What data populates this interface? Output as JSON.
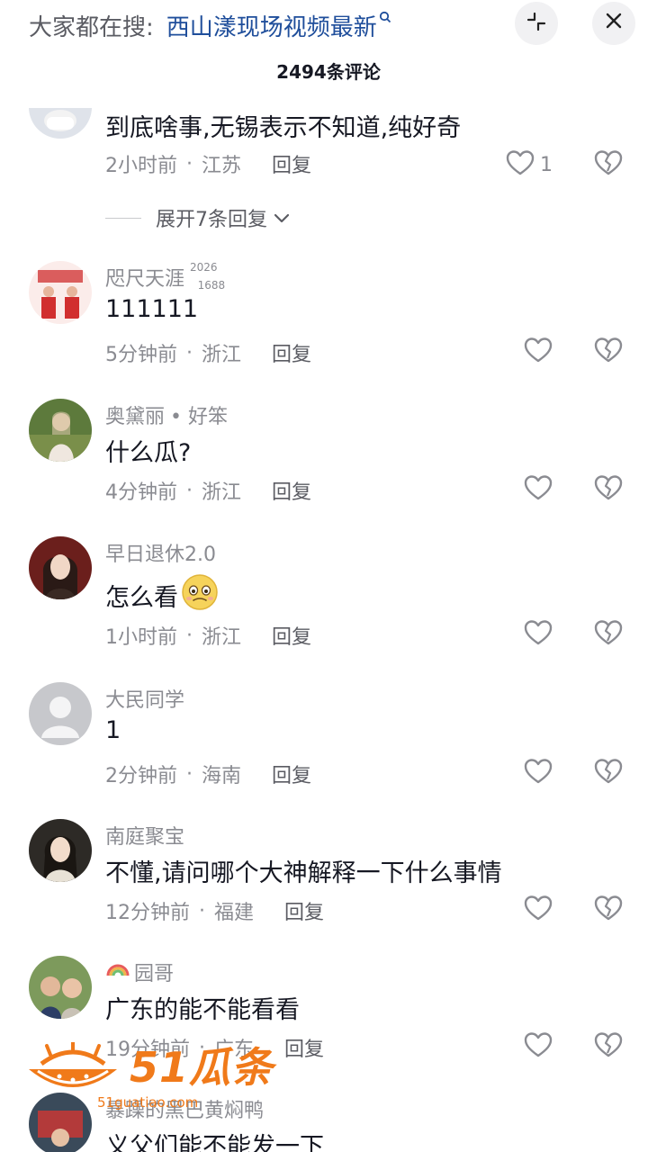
{
  "header": {
    "search_prefix": "大家都在搜:",
    "search_keyword": "西山漾现场视频最新",
    "comment_count": "2494条评论"
  },
  "comments": [
    {
      "text": "到底啥事,无锡表示不知道,纯好奇",
      "time": "2小时前",
      "location": "江苏",
      "reply": "回复",
      "likes": "1",
      "expand": "展开7条回复"
    },
    {
      "username": "咫尺天涯",
      "badge_top": "2026",
      "badge_bottom": "1688",
      "text": "111111",
      "time": "5分钟前",
      "location": "浙江",
      "reply": "回复"
    },
    {
      "username": "奥黛丽",
      "tag": "• 好笨",
      "text": "什么瓜?",
      "time": "4分钟前",
      "location": "浙江",
      "reply": "回复"
    },
    {
      "username": "早日退休2.0",
      "text": "怎么看",
      "time": "1小时前",
      "location": "浙江",
      "reply": "回复"
    },
    {
      "username": "大民同学",
      "text": "1",
      "time": "2分钟前",
      "location": "海南",
      "reply": "回复"
    },
    {
      "username": "南庭聚宝",
      "text": "不懂,请问哪个大神解释一下什么事情",
      "time": "12分钟前",
      "location": "福建",
      "reply": "回复"
    },
    {
      "username": "园哥",
      "text": "广东的能不能看看",
      "time": "19分钟前",
      "location": "广东",
      "reply": "回复"
    },
    {
      "username": "暴躁的黑巴黄焖鸭",
      "text": "义父们能不能发一下"
    }
  ],
  "watermark": {
    "brand": "51瓜条",
    "url": "51guatiao.com"
  },
  "icons": {
    "search": "search-icon",
    "collapse": "collapse-icon",
    "close": "close-icon",
    "like": "heart-icon",
    "dislike": "broken-heart-icon",
    "chevron": "chevron-down-icon"
  },
  "colors": {
    "keyword": "#1f4e9b",
    "meta": "#8a8b91",
    "text": "#161823",
    "watermark": "#f07a1a"
  }
}
